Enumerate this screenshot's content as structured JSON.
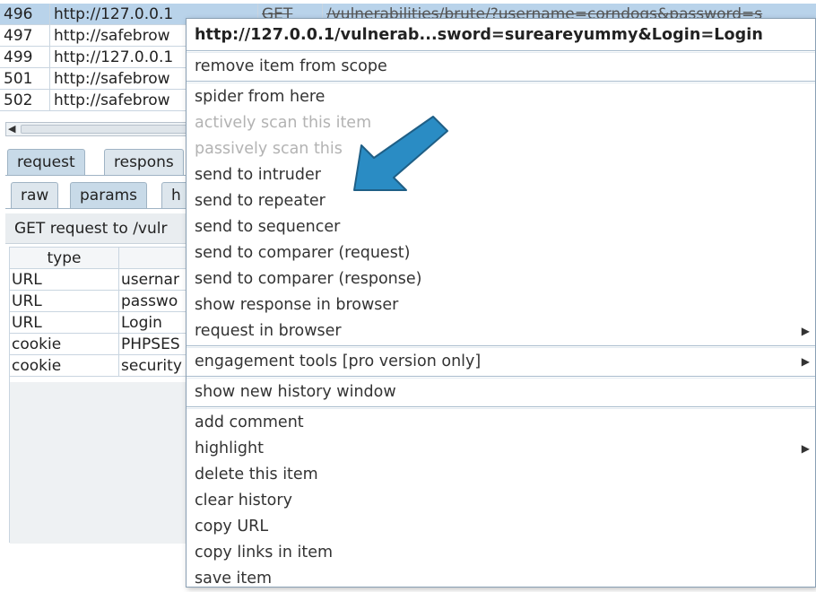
{
  "history": {
    "rows": [
      {
        "num": "496",
        "host": "http://127.0.0.1",
        "method": "GET",
        "url": "/vulnerabilities/brute/?username=corndogs&password=s",
        "selected": true
      },
      {
        "num": "497",
        "host": "http://safebrow"
      },
      {
        "num": "499",
        "host": "http://127.0.0.1"
      },
      {
        "num": "501",
        "host": "http://safebrow"
      },
      {
        "num": "502",
        "host": "http://safebrow"
      }
    ]
  },
  "tabs_top": [
    {
      "label": "request",
      "active": true
    },
    {
      "label": "respons",
      "active": false
    }
  ],
  "tabs_sub": [
    {
      "label": "raw",
      "active": false
    },
    {
      "label": "params",
      "active": true
    },
    {
      "label": "h",
      "active": false
    }
  ],
  "request_bar": "GET request to /vulr",
  "params_table": {
    "headers": [
      "type",
      ""
    ],
    "rows": [
      {
        "type": "URL",
        "name": "usernar"
      },
      {
        "type": "URL",
        "name": "passwo"
      },
      {
        "type": "URL",
        "name": "Login"
      },
      {
        "type": "cookie",
        "name": "PHPSES"
      },
      {
        "type": "cookie",
        "name": "security"
      }
    ]
  },
  "menu": {
    "title": "http://127.0.0.1/vulnerab...sword=sureareyummy&Login=Login",
    "remove_scope": "remove item from scope",
    "spider": "spider from here",
    "active_scan": "actively scan this item",
    "passive_scan": "passively scan this",
    "send_intruder": "send to intruder",
    "send_repeater": "send to repeater",
    "send_sequencer": "send to sequencer",
    "send_comparer_req": "send to comparer (request)",
    "send_comparer_resp": "send to comparer (response)",
    "show_response_browser": "show response in browser",
    "request_browser": "request in browser",
    "engagement_tools": "engagement tools [pro version only]",
    "new_history_window": "show new history window",
    "add_comment": "add comment",
    "highlight": "highlight",
    "delete_item": "delete this item",
    "clear_history": "clear history",
    "copy_url": "copy URL",
    "copy_links": "copy links in item",
    "save_item": "save item",
    "submenu_glyph": "▶"
  },
  "annotation": {
    "arrow_color": "#2a8cc4",
    "arrow_stroke": "#1f5f86"
  }
}
